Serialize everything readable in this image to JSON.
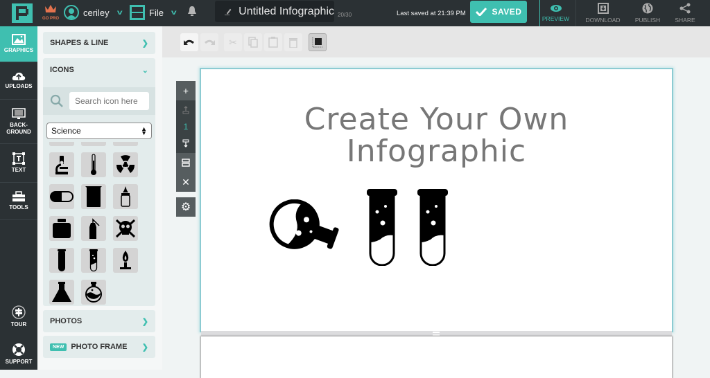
{
  "topbar": {
    "gopro_label": "GO PRO",
    "username": "ceriley",
    "file_label": "File",
    "document_title": "Untitled Infographic",
    "title_char_count": "20/30",
    "last_saved": "Last saved at 21:39 PM",
    "saved_label": "SAVED",
    "actions": [
      {
        "label": "PREVIEW",
        "icon": "eye-icon"
      },
      {
        "label": "DOWNLOAD",
        "icon": "download-icon"
      },
      {
        "label": "PUBLISH",
        "icon": "globe-icon"
      },
      {
        "label": "SHARE",
        "icon": "share-icon"
      }
    ]
  },
  "leftnav": {
    "items": [
      {
        "label": "GRAPHICS",
        "icon": "image-icon",
        "active": true
      },
      {
        "label": "UPLOADS",
        "icon": "cloud-upload-icon"
      },
      {
        "label": "BACK-\nGROUND",
        "icon": "monitor-icon"
      },
      {
        "label": "TEXT",
        "icon": "text-box-icon"
      },
      {
        "label": "TOOLS",
        "icon": "toolbox-icon"
      }
    ],
    "bottom": [
      {
        "label": "TOUR",
        "icon": "signpost-icon"
      },
      {
        "label": "SUPPORT",
        "icon": "lifebuoy-icon"
      }
    ]
  },
  "panel": {
    "shapes_label": "SHAPES & LINE",
    "icons_label": "ICONS",
    "search_placeholder": "Search icon here",
    "category_selected": "Science",
    "icons": [
      "microscope",
      "thermometer",
      "radiation",
      "pill",
      "beaker",
      "dropper-bottle",
      "jar",
      "wash-bottle",
      "skull-crossbones",
      "test-tube",
      "test-tube-bubbles",
      "bunsen-burner",
      "erlenmeyer-flask",
      "round-flask"
    ],
    "photos_label": "PHOTOS",
    "photo_frame_label": "PHOTO FRAME",
    "new_badge": "NEW"
  },
  "toolbar": {
    "tools": [
      "undo",
      "redo",
      "cut",
      "copy",
      "paste",
      "delete",
      "arrange"
    ]
  },
  "page_controls": {
    "page_number": "1"
  },
  "canvas": {
    "heading_line1": "Create Your Own",
    "heading_line2": "Infographic"
  },
  "colors": {
    "accent": "#3fbfb0",
    "topbar_bg": "#2b3134",
    "gopro": "#e5734e"
  }
}
